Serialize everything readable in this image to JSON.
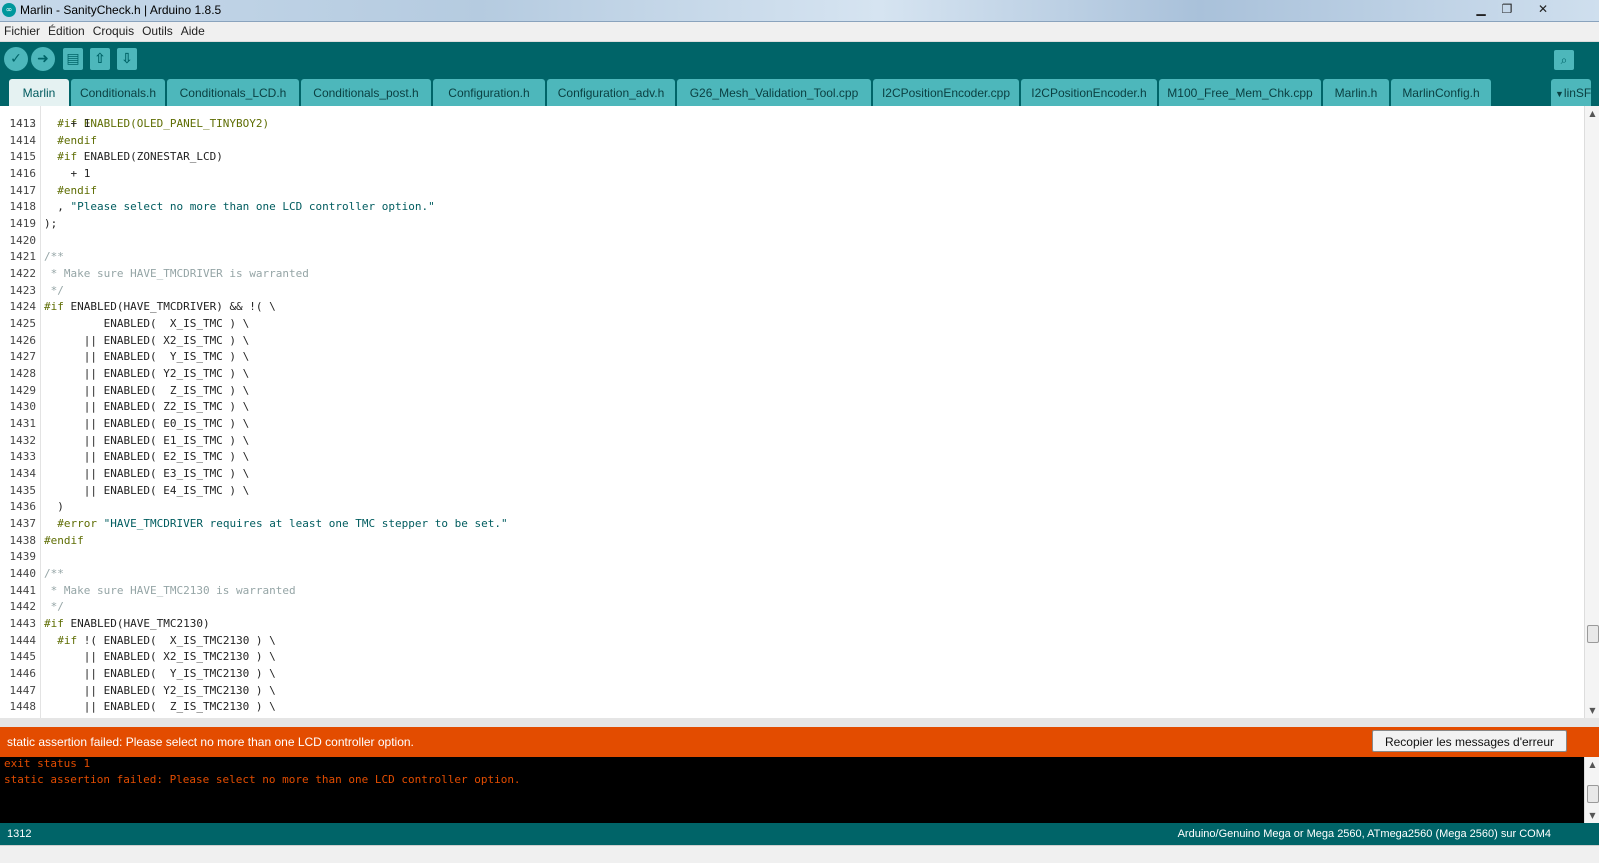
{
  "window": {
    "title": "Marlin - SanityCheck.h | Arduino 1.8.5",
    "app_icon": "arduino-logo-icon",
    "controls": {
      "minimize": "▁",
      "maximize": "❐",
      "close": "✕"
    }
  },
  "menu": [
    "Fichier",
    "Édition",
    "Croquis",
    "Outils",
    "Aide"
  ],
  "toolbar": {
    "verify_icon": "✓",
    "upload_icon": "➜",
    "new_icon": "▤",
    "open_icon": "⇧",
    "save_icon": "⇩",
    "serial_monitor_icon": "⌕"
  },
  "tabs": [
    "Marlin",
    "Conditionals.h",
    "Conditionals_LCD.h",
    "Conditionals_post.h",
    "Configuration.h",
    "Configuration_adv.h",
    "G26_Mesh_Validation_Tool.cpp",
    "I2CPositionEncoder.cpp",
    "I2CPositionEncoder.h",
    "M100_Free_Mem_Chk.cpp",
    "Marlin.h",
    "MarlinConfig.h"
  ],
  "tab_overflow_label": "linSF",
  "editor": {
    "first_line": 1413,
    "lines": [
      "    + 1",
      "  #endif",
      "  #if ENABLED(ZONESTAR_LCD)",
      "    + 1",
      "  #endif",
      "  , \"Please select no more than one LCD controller option.\"",
      ");",
      "",
      "/**",
      " * Make sure HAVE_TMCDRIVER is warranted",
      " */",
      "#if ENABLED(HAVE_TMCDRIVER) && !( \\",
      "         ENABLED(  X_IS_TMC ) \\",
      "      || ENABLED( X2_IS_TMC ) \\",
      "      || ENABLED(  Y_IS_TMC ) \\",
      "      || ENABLED( Y2_IS_TMC ) \\",
      "      || ENABLED(  Z_IS_TMC ) \\",
      "      || ENABLED( Z2_IS_TMC ) \\",
      "      || ENABLED( E0_IS_TMC ) \\",
      "      || ENABLED( E1_IS_TMC ) \\",
      "      || ENABLED( E2_IS_TMC ) \\",
      "      || ENABLED( E3_IS_TMC ) \\",
      "      || ENABLED( E4_IS_TMC ) \\",
      "  )",
      "  #error \"HAVE_TMCDRIVER requires at least one TMC stepper to be set.\"",
      "#endif",
      "",
      "/**",
      " * Make sure HAVE_TMC2130 is warranted",
      " */",
      "#if ENABLED(HAVE_TMC2130)",
      "  #if !( ENABLED(  X_IS_TMC2130 ) \\",
      "      || ENABLED( X2_IS_TMC2130 ) \\",
      "      || ENABLED(  Y_IS_TMC2130 ) \\",
      "      || ENABLED( Y2_IS_TMC2130 ) \\",
      "      || ENABLED(  Z_IS_TMC2130 ) \\"
    ]
  },
  "error_bar": {
    "message": "static assertion failed: Please select no more than one LCD controller option.",
    "copy_button": "Recopier les messages d'erreur"
  },
  "console": {
    "lines": [
      "exit status 1",
      "static assertion failed: Please select no more than one LCD controller option."
    ]
  },
  "status": {
    "line_number": "1312",
    "board": "Arduino/Genuino Mega or Mega 2560, ATmega2560 (Mega 2560) sur COM4"
  },
  "colors": {
    "teal_dark": "#006468",
    "teal_tab": "#4db7bb",
    "error_orange": "#e34c00"
  }
}
